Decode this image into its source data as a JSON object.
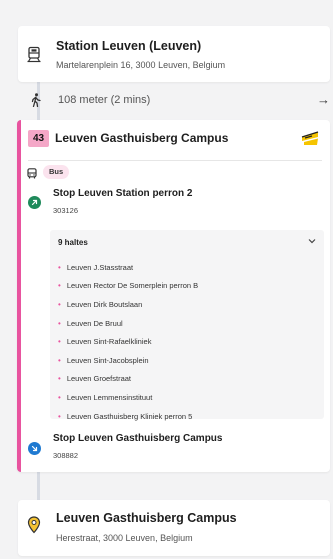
{
  "origin": {
    "title": "Station Leuven (Leuven)",
    "address": "Martelarenplein 16, 3000 Leuven, Belgium",
    "icon": "train-station-icon"
  },
  "walk": {
    "text": "108 meter (2 mins)",
    "icon": "walking-person-icon",
    "arrow": "→"
  },
  "leg": {
    "line_number": "43",
    "line_name": "Leuven Gasthuisberg Campus",
    "line_color": "#e8539f",
    "badge_color": "#f4a7c7",
    "operator_logo": "de-lijn-logo",
    "mode_label": "Bus",
    "start_stop": {
      "name": "Stop Leuven Station perron 2",
      "code": "303126",
      "dot_color": "#1f8a5b"
    },
    "stops_summary": "9 haltes",
    "intermediate_stops": [
      "Leuven J.Stasstraat",
      "Leuven Rector De Somerplein perron B",
      "Leuven Dirk Boutslaan",
      "Leuven De Bruul",
      "Leuven Sint-Rafaelkliniek",
      "Leuven Sint-Jacobsplein",
      "Leuven Groefstraat",
      "Leuven Lemmensinstituut",
      "Leuven Gasthuisberg Kliniek perron 5"
    ],
    "end_stop": {
      "name": "Stop Leuven Gasthuisberg Campus",
      "code": "308882",
      "dot_color": "#1f7ad1"
    }
  },
  "destination": {
    "title": "Leuven Gasthuisberg Campus",
    "address": "Herestraat, 3000 Leuven, Belgium",
    "icon": "location-pin-icon"
  }
}
